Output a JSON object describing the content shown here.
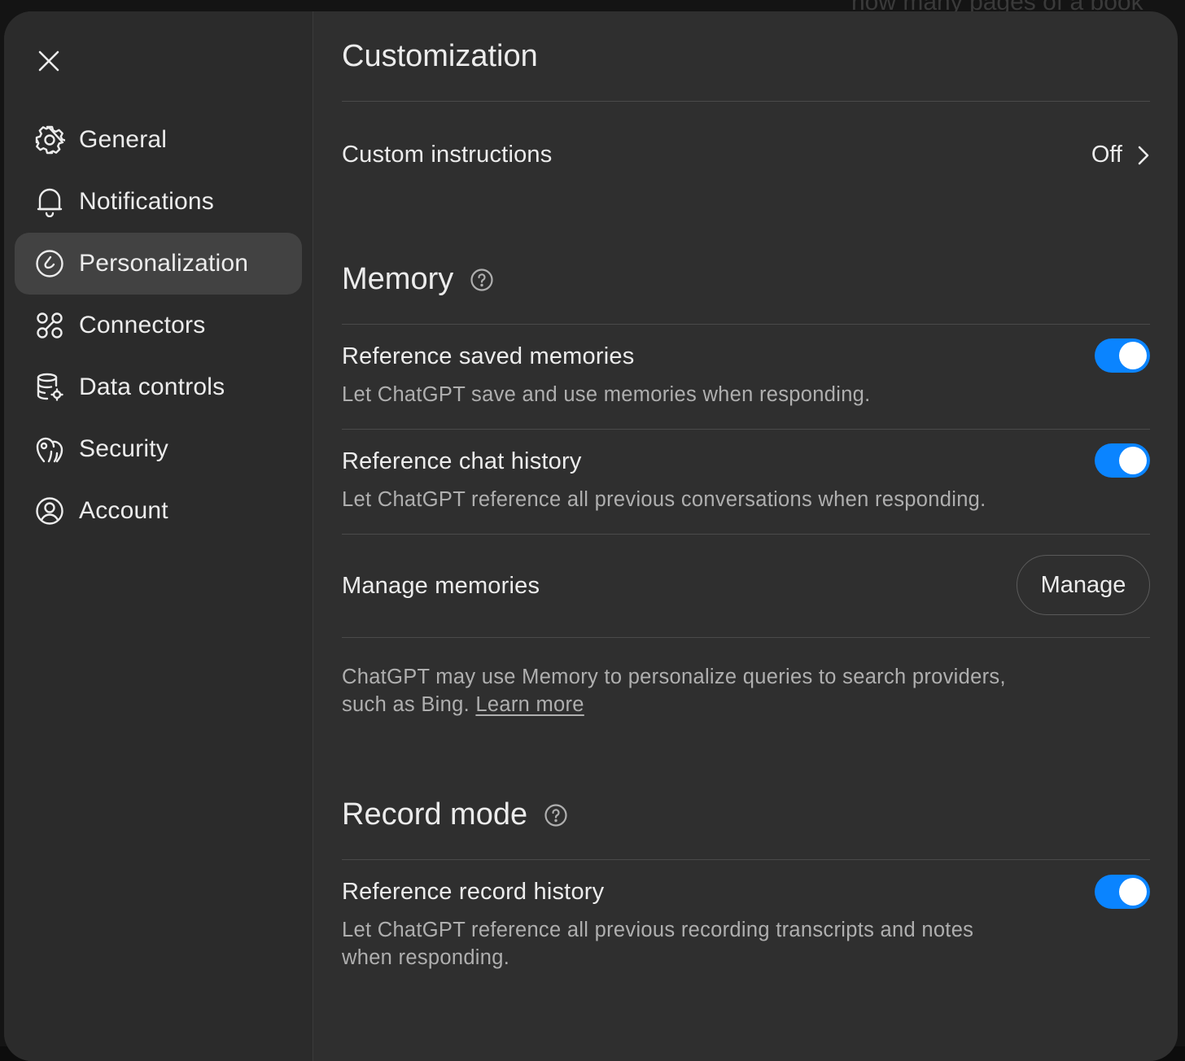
{
  "background": {
    "partial_text": "how many pages of a book"
  },
  "sidebar": {
    "close_icon": "close-icon",
    "items": [
      {
        "label": "General",
        "icon": "gear-icon",
        "active": false
      },
      {
        "label": "Notifications",
        "icon": "bell-icon",
        "active": false
      },
      {
        "label": "Personalization",
        "icon": "personalization-icon",
        "active": true
      },
      {
        "label": "Connectors",
        "icon": "connectors-icon",
        "active": false
      },
      {
        "label": "Data controls",
        "icon": "database-gear-icon",
        "active": false
      },
      {
        "label": "Security",
        "icon": "security-icon",
        "active": false
      },
      {
        "label": "Account",
        "icon": "user-circle-icon",
        "active": false
      }
    ]
  },
  "main": {
    "title": "Customization",
    "custom_instructions": {
      "label": "Custom instructions",
      "value": "Off"
    },
    "memory": {
      "title": "Memory",
      "reference_saved": {
        "label": "Reference saved memories",
        "description": "Let ChatGPT save and use memories when responding.",
        "enabled": true
      },
      "reference_chat": {
        "label": "Reference chat history",
        "description": "Let ChatGPT reference all previous conversations when responding.",
        "enabled": true
      },
      "manage": {
        "label": "Manage memories",
        "button": "Manage"
      },
      "note_line1": "ChatGPT may use Memory to personalize queries to search providers,",
      "note_line2": "such as Bing.",
      "learn_more": "Learn more"
    },
    "record_mode": {
      "title": "Record mode",
      "reference_record": {
        "label": "Reference record history",
        "description_line1": "Let ChatGPT reference all previous recording transcripts and notes",
        "description_line2": "when responding.",
        "enabled": true
      }
    }
  },
  "colors": {
    "accent": "#0a84ff",
    "panel": "#2f2f2f",
    "active_item": "#424242",
    "text_primary": "#ececec",
    "text_secondary": "#afafaf"
  }
}
